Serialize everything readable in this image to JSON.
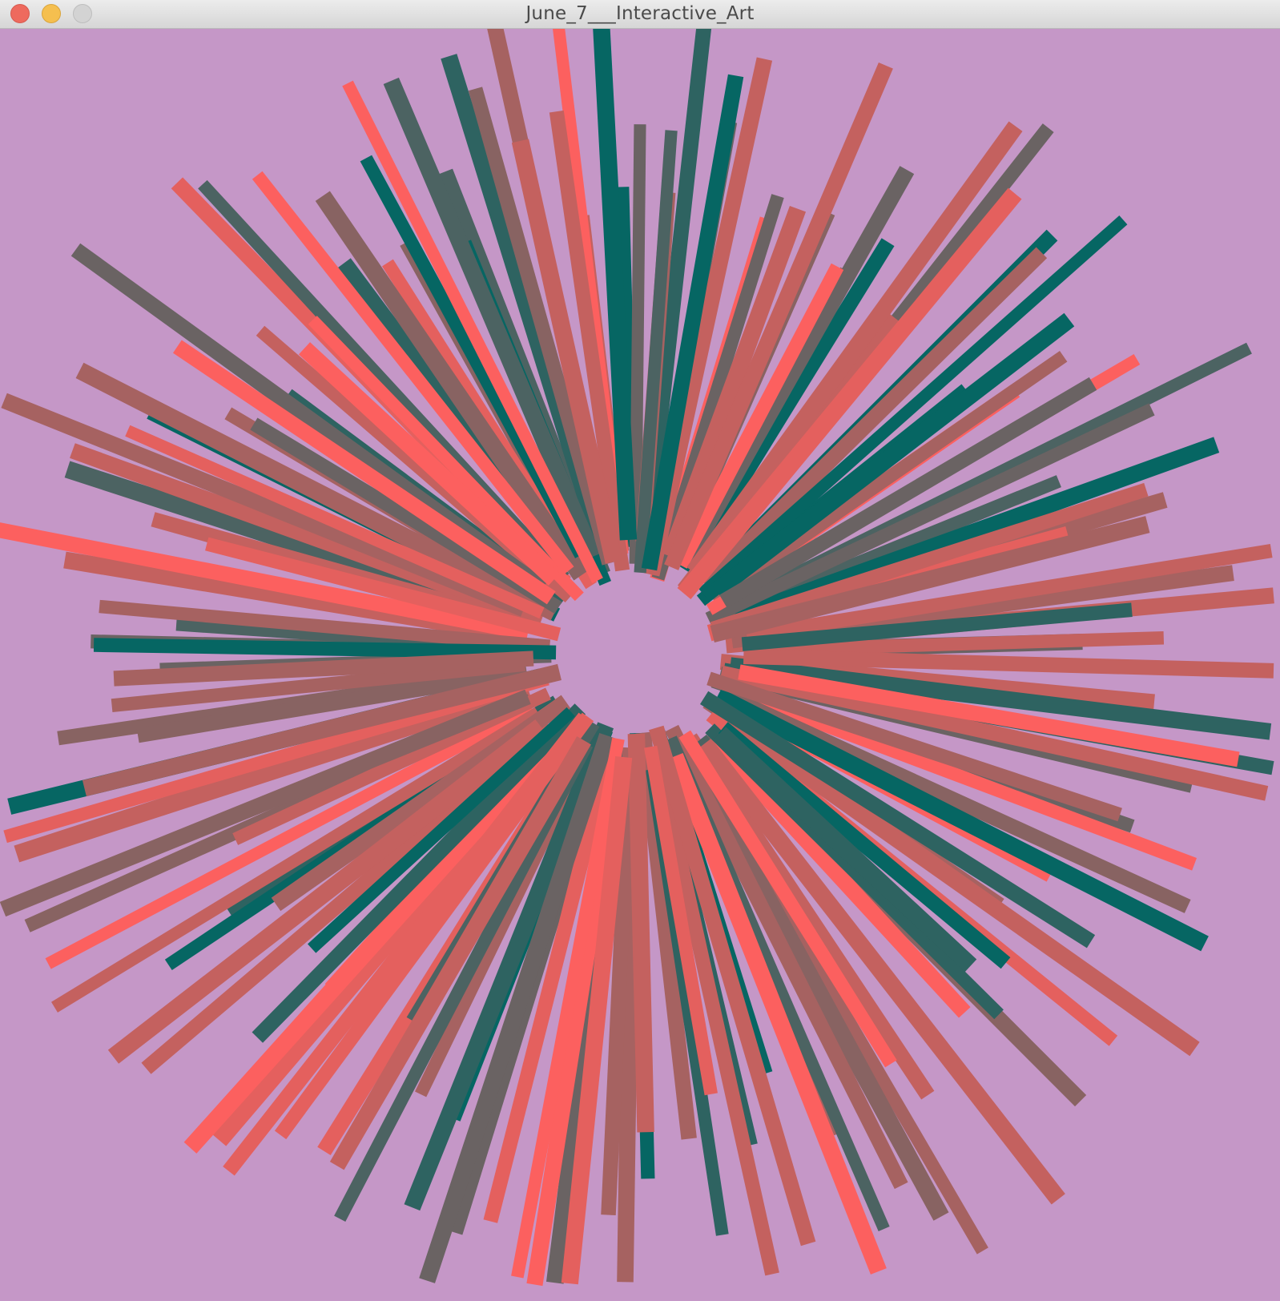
{
  "window": {
    "title": "June_7___Interactive_Art"
  },
  "canvas": {
    "background": "#c597c7",
    "palette": [
      "#066663",
      "#2e6361",
      "#4c6362",
      "#6a6363",
      "#886362",
      "#a66261",
      "#c4615f",
      "#e4605e",
      "#fc605f"
    ]
  }
}
